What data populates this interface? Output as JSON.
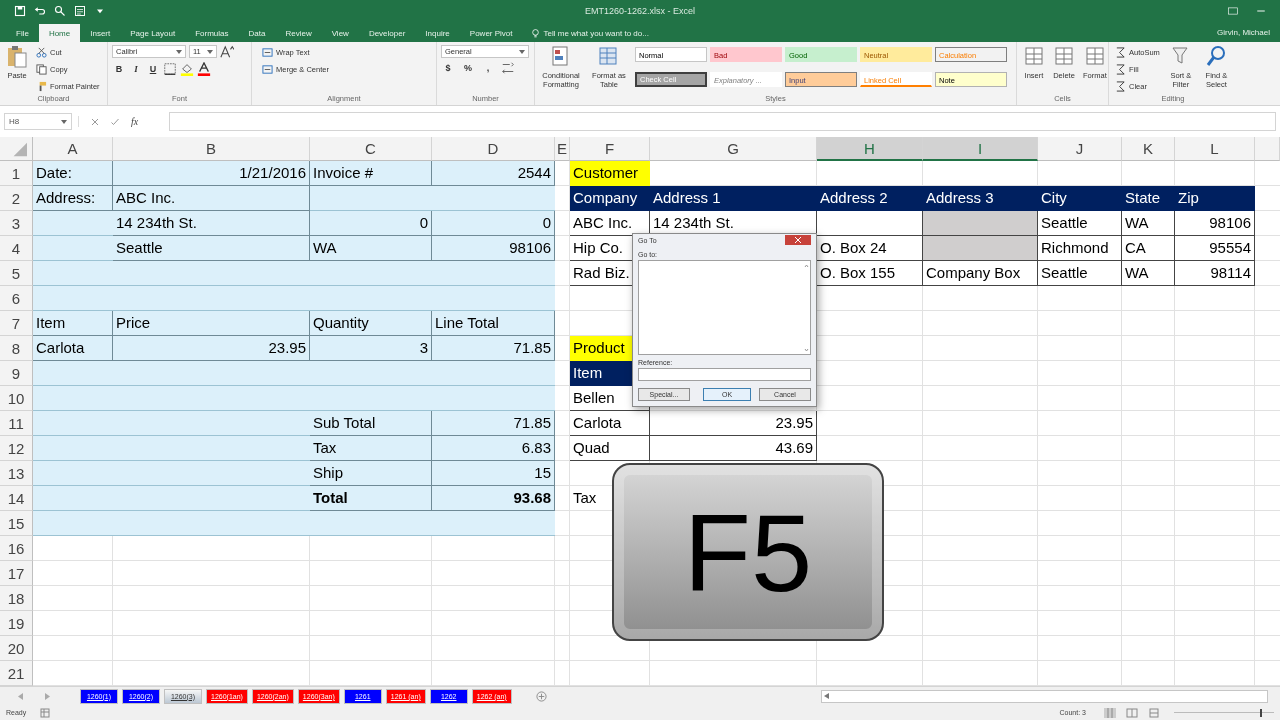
{
  "title_bar": {
    "title": "EMT1260-1262.xlsx - Excel"
  },
  "ribbon_tabs": [
    {
      "label": "File",
      "selected": false
    },
    {
      "label": "Home",
      "selected": true
    },
    {
      "label": "Insert",
      "selected": false
    },
    {
      "label": "Page Layout",
      "selected": false
    },
    {
      "label": "Formulas",
      "selected": false
    },
    {
      "label": "Data",
      "selected": false
    },
    {
      "label": "Review",
      "selected": false
    },
    {
      "label": "View",
      "selected": false
    },
    {
      "label": "Developer",
      "selected": false
    },
    {
      "label": "Inquire",
      "selected": false
    },
    {
      "label": "Power Pivot",
      "selected": false
    }
  ],
  "tell_me": "Tell me what you want to do...",
  "user": "Girvin, Michael",
  "ribbon": {
    "clipboard": {
      "paste": "Paste",
      "items": [
        "Cut",
        "Copy",
        "Format Painter"
      ],
      "label": "Clipboard"
    },
    "font": {
      "name": "Calibri",
      "size": "11",
      "buttons": [
        "B",
        "I",
        "U"
      ],
      "label": "Font"
    },
    "alignment": {
      "items": [
        "Wrap Text",
        "Merge & Center"
      ],
      "label": "Alignment"
    },
    "number": {
      "format": "General",
      "symbols": [
        "$",
        "%",
        ","
      ],
      "label": "Number"
    },
    "styles": {
      "buttons": [
        "Conditional Formatting",
        "Format as Table"
      ],
      "cells": [
        {
          "label": "Normal",
          "kind": "normal"
        },
        {
          "label": "Bad",
          "kind": "bad"
        },
        {
          "label": "Good",
          "kind": "good"
        },
        {
          "label": "Neutral",
          "kind": "neutral"
        },
        {
          "label": "Calculation",
          "kind": "calculation"
        },
        {
          "label": "Check Cell",
          "kind": "check"
        },
        {
          "label": "Explanatory ...",
          "kind": "explanatory"
        },
        {
          "label": "Input",
          "kind": "input"
        },
        {
          "label": "Linked Cell",
          "kind": "linked"
        },
        {
          "label": "Note",
          "kind": "note"
        }
      ],
      "label": "Styles"
    },
    "cells": {
      "buttons": [
        "Insert",
        "Delete",
        "Format"
      ],
      "label": "Cells"
    },
    "editing": {
      "items": [
        "AutoSum",
        "Fill",
        "Clear"
      ],
      "buttons": [
        "Sort & Filter",
        "Find & Select"
      ],
      "label": "Editing"
    }
  },
  "formula_bar": {
    "name_box": "H8",
    "fx": "fx"
  },
  "sheet": {
    "columns": [
      {
        "letter": "A",
        "selected": false
      },
      {
        "letter": "B",
        "selected": false
      },
      {
        "letter": "C",
        "selected": false
      },
      {
        "letter": "D",
        "selected": false
      },
      {
        "letter": "E",
        "selected": false
      },
      {
        "letter": "F",
        "selected": false
      },
      {
        "letter": "G",
        "selected": false
      },
      {
        "letter": "H",
        "selected": true
      },
      {
        "letter": "I",
        "selected": true
      },
      {
        "letter": "J",
        "selected": false
      },
      {
        "letter": "K",
        "selected": false
      },
      {
        "letter": "L",
        "selected": false
      }
    ],
    "rows": [
      {
        "number": "1",
        "invoice_band": true,
        "cells": [
          {
            "text": "Date:"
          },
          {
            "text": "1/21/2016",
            "numeric": true
          },
          {
            "text": "Invoice #"
          },
          {
            "text": "2544",
            "numeric": true
          },
          {},
          {
            "text": "Customer",
            "kind": "label"
          }
        ]
      },
      {
        "number": "2",
        "invoice_band": true,
        "cells": [
          {
            "text": "Address:"
          },
          {
            "text": "ABC Inc."
          },
          {},
          {},
          {},
          {
            "text": "Company",
            "kind": "header"
          },
          {
            "text": "Address 1",
            "kind": "header"
          },
          {
            "text": "Address 2",
            "kind": "header"
          },
          {
            "text": "Address 3",
            "kind": "header"
          },
          {
            "text": "City",
            "kind": "header"
          },
          {
            "text": "State",
            "kind": "header"
          },
          {
            "text": "Zip",
            "kind": "header"
          }
        ]
      },
      {
        "number": "3",
        "invoice_band": true,
        "cells": [
          {},
          {
            "text": "14 234th St."
          },
          {
            "text": "0",
            "numeric": true
          },
          {
            "text": "0",
            "numeric": true
          },
          {},
          {
            "text": "ABC Inc.",
            "kind": "table"
          },
          {
            "text": "14 234th St.",
            "kind": "table"
          },
          {
            "kind": "table"
          },
          {
            "kind": "shaded"
          },
          {
            "text": "Seattle",
            "kind": "table"
          },
          {
            "text": "WA",
            "kind": "table"
          },
          {
            "text": "98106",
            "numeric": true,
            "kind": "table"
          }
        ]
      },
      {
        "number": "4",
        "invoice_band": true,
        "cells": [
          {},
          {
            "text": "Seattle"
          },
          {
            "text": "WA"
          },
          {
            "text": "98106",
            "numeric": true
          },
          {},
          {
            "text": "Hip Co.",
            "kind": "table"
          },
          {},
          {
            "text": "O. Box 24",
            "kind": "table"
          },
          {
            "kind": "shaded"
          },
          {
            "text": "Richmond",
            "kind": "table"
          },
          {
            "text": "CA",
            "kind": "table"
          },
          {
            "text": "95554",
            "numeric": true,
            "kind": "table"
          }
        ]
      },
      {
        "number": "5",
        "invoice_band": true,
        "cells": [
          {},
          {},
          {},
          {},
          {},
          {
            "text": "Rad Biz.",
            "kind": "table"
          },
          {},
          {
            "text": "O. Box 155",
            "kind": "table"
          },
          {
            "text": "Company Box",
            "kind": "table"
          },
          {
            "text": "Seattle",
            "kind": "table"
          },
          {
            "text": "WA",
            "kind": "table"
          },
          {
            "text": "98114",
            "numeric": true,
            "kind": "table"
          }
        ]
      },
      {
        "number": "6",
        "invoice_band": true,
        "cells": []
      },
      {
        "number": "7",
        "invoice_band": true,
        "cells": [
          {
            "text": "Item"
          },
          {
            "text": "Price"
          },
          {
            "text": "Quantity"
          },
          {
            "text": "Line Total"
          }
        ]
      },
      {
        "number": "8",
        "invoice_band": true,
        "cells": [
          {
            "text": "Carlota"
          },
          {
            "text": "23.95",
            "numeric": true
          },
          {
            "text": "3",
            "numeric": true
          },
          {
            "text": "71.85",
            "numeric": true
          },
          {},
          {
            "text": "Product",
            "kind": "label"
          }
        ]
      },
      {
        "number": "9",
        "invoice_band": true,
        "cells": [
          {},
          {},
          {},
          {},
          {},
          {
            "text": "Item",
            "kind": "header"
          }
        ]
      },
      {
        "number": "10",
        "invoice_band": true,
        "cells": [
          {},
          {},
          {},
          {},
          {},
          {
            "text": "Bellen",
            "kind": "table"
          }
        ]
      },
      {
        "number": "11",
        "invoice_band": true,
        "cells": [
          {},
          {},
          {
            "text": "Sub Total"
          },
          {
            "text": "71.85",
            "numeric": true
          },
          {},
          {
            "text": "Carlota",
            "kind": "table"
          },
          {
            "text": "23.95",
            "numeric": true,
            "kind": "table"
          }
        ]
      },
      {
        "number": "12",
        "invoice_band": true,
        "cells": [
          {},
          {},
          {
            "text": "Tax"
          },
          {
            "text": "6.83",
            "numeric": true
          },
          {},
          {
            "text": "Quad",
            "kind": "table"
          },
          {
            "text": "43.69",
            "numeric": true,
            "kind": "table"
          }
        ]
      },
      {
        "number": "13",
        "invoice_band": true,
        "cells": [
          {},
          {},
          {
            "text": "Ship"
          },
          {
            "text": "15",
            "numeric": true
          }
        ]
      },
      {
        "number": "14",
        "invoice_band": true,
        "cells": [
          {},
          {},
          {
            "text": "Total",
            "bold": true
          },
          {
            "text": "93.68",
            "numeric": true,
            "bold": true
          },
          {},
          {
            "text": "Tax"
          }
        ]
      },
      {
        "number": "15",
        "invoice_band": true,
        "cells": []
      },
      {
        "number": "16",
        "invoice_band": false,
        "cells": []
      },
      {
        "number": "17",
        "invoice_band": false,
        "cells": []
      },
      {
        "number": "18",
        "invoice_band": false,
        "cells": []
      },
      {
        "number": "19",
        "invoice_band": false,
        "cells": []
      },
      {
        "number": "20",
        "invoice_band": false,
        "cells": []
      },
      {
        "number": "21",
        "invoice_band": false,
        "cells": []
      }
    ]
  },
  "go_to_dialog": {
    "title": "Go To",
    "list_label": "Go to:",
    "reference_label": "Reference:",
    "buttons": [
      {
        "label": "Special...",
        "kind": "normal"
      },
      {
        "label": "OK",
        "kind": "default"
      },
      {
        "label": "Cancel",
        "kind": "normal"
      }
    ]
  },
  "f5_key": {
    "label": "F5"
  },
  "sheet_tabs": [
    {
      "label": "1260(1)",
      "color": "#0000ff",
      "selected": false
    },
    {
      "label": "1260(2)",
      "color": "#0000ff",
      "selected": false
    },
    {
      "label": "1260(3)",
      "selected": true
    },
    {
      "label": "1260(1an)",
      "color": "#ff0000",
      "selected": false
    },
    {
      "label": "1260(2an)",
      "color": "#ff0000",
      "selected": false
    },
    {
      "label": "1260(3an)",
      "color": "#ff0000",
      "selected": false
    },
    {
      "label": "1261",
      "color": "#0000ff",
      "selected": false
    },
    {
      "label": "1261 (an)",
      "color": "#ff0000",
      "selected": false
    },
    {
      "label": "1262",
      "color": "#0000ff",
      "selected": false
    },
    {
      "label": "1262 (an)",
      "color": "#ff0000",
      "selected": false
    }
  ],
  "status_bar": {
    "mode": "Ready",
    "count": "Count: 3",
    "zoom_slider": {
      "level": 0.88
    }
  }
}
